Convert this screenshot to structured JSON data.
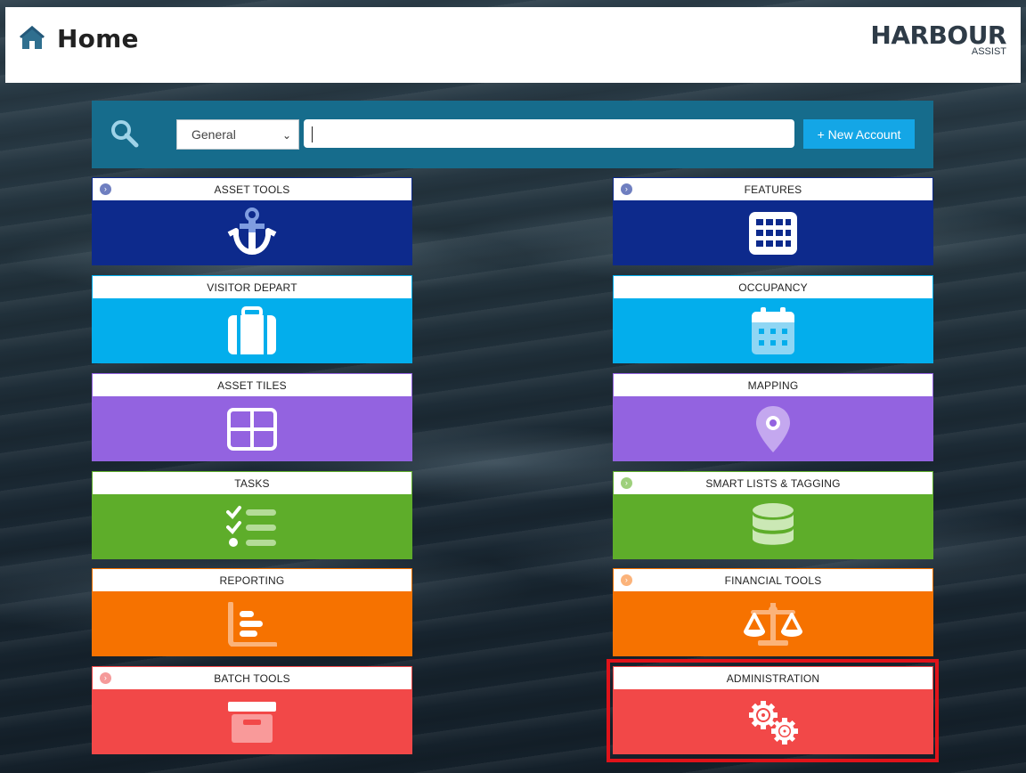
{
  "header": {
    "title": "Home",
    "home_icon": "home-icon",
    "logo": {
      "main": "HARBOUR",
      "sub": "ASSIST"
    }
  },
  "search": {
    "icon": "search-icon",
    "type_selected": "General",
    "input_value": "",
    "new_account_label": "New Account"
  },
  "tiles": [
    {
      "label": "ASSET TOOLS",
      "color": "#0d2a8c",
      "icon": "anchor-icon",
      "has_expander": true
    },
    {
      "label": "FEATURES",
      "color": "#0d2a8c",
      "icon": "grid-icon",
      "has_expander": true
    },
    {
      "label": "VISITOR DEPART",
      "color": "#03aeec",
      "icon": "suitcase-icon",
      "has_expander": false
    },
    {
      "label": "OCCUPANCY",
      "color": "#03aeec",
      "icon": "calendar-icon",
      "has_expander": false
    },
    {
      "label": "ASSET TILES",
      "color": "#9363e0",
      "icon": "tiles-icon",
      "has_expander": false
    },
    {
      "label": "MAPPING",
      "color": "#9363e0",
      "icon": "map-pin-icon",
      "has_expander": false
    },
    {
      "label": "TASKS",
      "color": "#5ead2a",
      "icon": "task-list-icon",
      "has_expander": false
    },
    {
      "label": "SMART LISTS & TAGGING",
      "color": "#5ead2a",
      "icon": "database-icon",
      "has_expander": true
    },
    {
      "label": "REPORTING",
      "color": "#f67200",
      "icon": "bar-chart-icon",
      "has_expander": false
    },
    {
      "label": "FINANCIAL TOOLS",
      "color": "#f67200",
      "icon": "scales-icon",
      "has_expander": true
    },
    {
      "label": "BATCH TOOLS",
      "color": "#f24848",
      "icon": "archive-box-icon",
      "has_expander": true
    },
    {
      "label": "ADMINISTRATION",
      "color": "#f24848",
      "icon": "gears-icon",
      "has_expander": false
    }
  ],
  "highlighted_tile": "ADMINISTRATION",
  "highlight_color": "#e0131a"
}
